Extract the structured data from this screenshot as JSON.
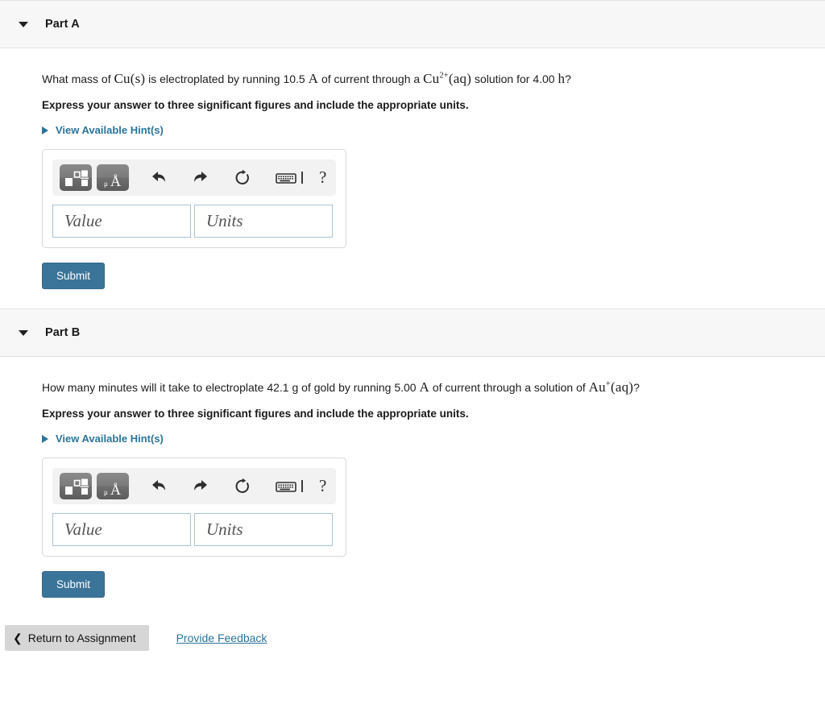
{
  "parts": [
    {
      "id": "part-a",
      "title": "Part A",
      "toggle_icon": "triangle-down-icon",
      "question": {
        "pre": "What mass of ",
        "m1": "Cu(s)",
        "mid1": " is electroplated by running 10.5 ",
        "m2": "A",
        "mid2": " of current through a ",
        "m3_base": "Cu",
        "m3_sup": "2+",
        "m3_tail": "(aq)",
        "mid3": " solution for 4.00 ",
        "m4": "h",
        "post": "?"
      },
      "instruction": "Express your answer to three significant figures and include the appropriate units.",
      "hint_label": "View Available Hint(s)",
      "hint_icon": "triangle-right-icon",
      "toolbar": {
        "template_button": "math-template-icon",
        "units_button": "units-angstrom-icon",
        "undo": "undo-arrow-icon",
        "redo": "redo-arrow-icon",
        "reset": "reset-circular-arrow-icon",
        "keyboard": "keyboard-icon",
        "caret": "text-caret-icon",
        "help": "?"
      },
      "value_placeholder": "Value",
      "units_placeholder": "Units",
      "value_text": "",
      "units_text": "",
      "submit_label": "Submit"
    },
    {
      "id": "part-b",
      "title": "Part B",
      "toggle_icon": "triangle-down-icon",
      "question": {
        "pre": "How many minutes will it take to electroplate 42.1 g of gold by running 5.00 ",
        "m1": "A",
        "mid1": " of current through a solution of ",
        "m3_base": "Au",
        "m3_sup": "+",
        "m3_tail": "(aq)",
        "post": "?"
      },
      "instruction": "Express your answer to three significant figures and include the appropriate units.",
      "hint_label": "View Available Hint(s)",
      "hint_icon": "triangle-right-icon",
      "toolbar": {
        "template_button": "math-template-icon",
        "units_button": "units-angstrom-icon",
        "undo": "undo-arrow-icon",
        "redo": "redo-arrow-icon",
        "reset": "reset-circular-arrow-icon",
        "keyboard": "keyboard-icon",
        "caret": "text-caret-icon",
        "help": "?"
      },
      "value_placeholder": "Value",
      "units_placeholder": "Units",
      "value_text": "",
      "units_text": "",
      "submit_label": "Submit"
    }
  ],
  "footer": {
    "return_label": "Return to Assignment",
    "return_icon": "chevron-left-icon",
    "feedback_label": "Provide Feedback"
  },
  "colors": {
    "accent_link": "#2b7499",
    "submit_bg": "#3a7499",
    "header_bg": "#f7f7f7",
    "return_bg": "#d6d6d6",
    "field_border": "#a8c4d4"
  }
}
